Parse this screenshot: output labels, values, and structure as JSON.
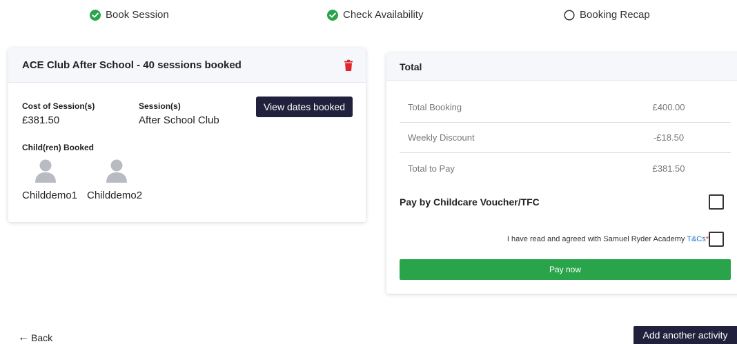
{
  "steps": [
    {
      "label": "Book Session",
      "status": "complete"
    },
    {
      "label": "Check Availability",
      "status": "complete"
    },
    {
      "label": "Booking Recap",
      "status": "pending"
    }
  ],
  "booking": {
    "title": "ACE Club After School - 40 sessions booked",
    "cost_label": "Cost of Session(s)",
    "cost_value": "£381.50",
    "session_label": "Session(s)",
    "session_value": "After School Club",
    "view_dates_label": "View dates booked",
    "children_label": "Child(ren) Booked",
    "children": [
      {
        "name": "Childdemo1"
      },
      {
        "name": "Childdemo2"
      }
    ]
  },
  "total": {
    "title": "Total",
    "rows": [
      {
        "label": "Total Booking",
        "value": "£400.00"
      },
      {
        "label": "Weekly Discount",
        "value": "-£18.50"
      },
      {
        "label": "Total to Pay",
        "value": "£381.50"
      }
    ],
    "voucher_label": "Pay by Childcare Voucher/TFC",
    "terms_text": "I have read and agreed with Samuel Ryder Academy",
    "terms_link": "T&Cs",
    "terms_required": "*",
    "pay_label": "Pay now"
  },
  "nav": {
    "back_label": "Back",
    "add_activity_label": "Add another activity"
  },
  "colors": {
    "check_green": "#2aa44a",
    "dark_button": "#22213d",
    "trash_red": "#e0262c",
    "link_blue": "#1a73c8"
  },
  "icons": [
    "check-circle-icon",
    "circle-outline-icon",
    "trash-icon",
    "avatar-icon",
    "arrow-left-icon"
  ]
}
